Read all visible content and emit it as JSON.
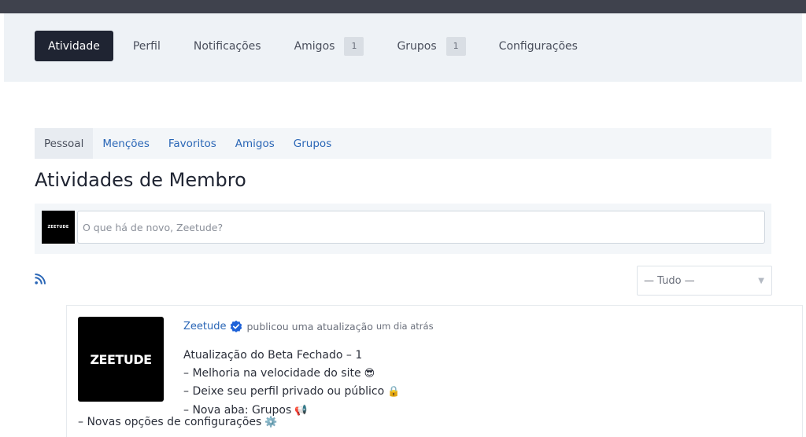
{
  "nav": {
    "items": [
      {
        "label": "Atividade"
      },
      {
        "label": "Perfil"
      },
      {
        "label": "Notificações"
      },
      {
        "label": "Amigos",
        "count": "1"
      },
      {
        "label": "Grupos",
        "count": "1"
      },
      {
        "label": "Configurações"
      }
    ]
  },
  "subnav": {
    "items": [
      {
        "label": "Pessoal"
      },
      {
        "label": "Menções"
      },
      {
        "label": "Favoritos"
      },
      {
        "label": "Amigos"
      },
      {
        "label": "Grupos"
      }
    ]
  },
  "page_title": "Atividades de Membro",
  "post": {
    "avatar_text": "ZEETUDE",
    "placeholder": "O que há de novo, Zeetude?"
  },
  "filter": {
    "selected": "— Tudo —"
  },
  "activity": {
    "avatar_text": "ZEETUDE",
    "user": "Zeetude",
    "action": "publicou uma atualização",
    "time": "um dia atrás",
    "lines": [
      "Atualização do Beta Fechado – 1",
      "– Melhoria na velocidade do site",
      "– Deixe seu perfil privado ou público",
      "– Nova aba: Grupos"
    ],
    "last_line": "– Novas opções de configurações",
    "emojis": [
      "😎",
      "🔒",
      "📢",
      "⚙️"
    ]
  },
  "colors": {
    "accent": "#2a66b6",
    "nav_active_bg": "#1f2432",
    "topbar": "#3f424d",
    "verified": "#1e62d8"
  }
}
